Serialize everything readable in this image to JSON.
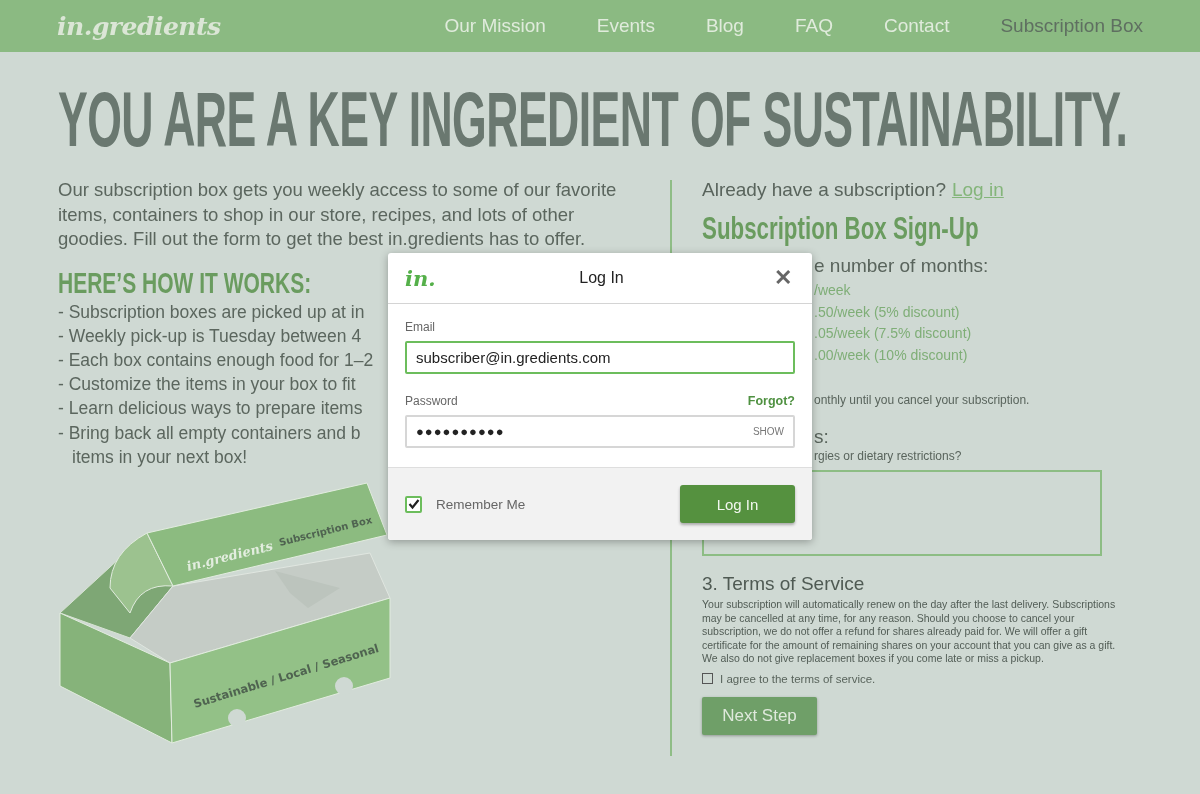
{
  "nav": {
    "logo": "in.gredients",
    "items": [
      {
        "label": "Our Mission",
        "selected": false
      },
      {
        "label": "Events",
        "selected": false
      },
      {
        "label": "Blog",
        "selected": false
      },
      {
        "label": "FAQ",
        "selected": false
      },
      {
        "label": "Contact",
        "selected": false
      },
      {
        "label": "Subscription Box",
        "selected": true
      }
    ]
  },
  "headline": "YOU ARE A KEY INGREDIENT OF SUSTAINABILITY.",
  "intro": "Our subscription box gets you weekly access to some of our favorite items, containers to shop in our store, recipes, and lots of other goodies. Fill out the form to get the best in.gredients has to offer.",
  "how_it_works": {
    "title": "HERE’S HOW IT WORKS:",
    "items": [
      {
        "kind": "bullet",
        "text": "- Subscription boxes are picked up at in"
      },
      {
        "kind": "bullet",
        "text": "- Weekly pick-up is Tuesday between 4"
      },
      {
        "kind": "bullet",
        "text": "- Each box contains enough food for 1–2"
      },
      {
        "kind": "bullet",
        "text": "- Customize the items in your box to fit"
      },
      {
        "kind": "bullet",
        "text": "- Learn delicious ways to prepare items"
      },
      {
        "kind": "bullet",
        "text": "- Bring back all empty containers and b"
      },
      {
        "kind": "continuation",
        "text": "items in your next box!"
      }
    ]
  },
  "box_art": {
    "brand": "in.gredients",
    "lid_label": "Subscription Box",
    "side_label": "Sustainable / Local / Seasonal"
  },
  "signup": {
    "prompt": "Already have a subscription?",
    "login_link": "Log in",
    "title": "Subscription Box Sign-Up",
    "step_1_heading": "e number of months:",
    "options": [
      "/week",
      ".50/week (5% discount)",
      ".05/week (7.5% discount)",
      ".00/week (10% discount)"
    ],
    "renewal_note": "onthly until you cancel your subscription.",
    "step_2_heading": "s:",
    "step_2_question": "rgies or dietary restrictions?",
    "terms": {
      "heading": "3. Terms of Service",
      "body": "Your subscription will automatically renew on the day after the last delivery. Subscriptions may be cancelled at any time, for any reason. Should you choose to cancel your subscription, we do not offer a refund for shares already paid for. We will offer a gift certificate for the amount of remaining shares on your account that you can give as a gift. We also do not give replacement boxes if you come late or miss a pickup.",
      "agree_label": "I agree to the terms of service.",
      "agreed": false
    },
    "next_button": "Next Step"
  },
  "login_modal": {
    "logo": "in.",
    "title": "Log In",
    "close": "✕",
    "email_label": "Email",
    "email_value": "subscriber@in.gredients.com",
    "password_label": "Password",
    "forgot_link": "Forgot?",
    "password_value": "●●●●●●●●●●",
    "show_button": "SHOW",
    "remember_label": "Remember Me",
    "remember": true,
    "submit": "Log In"
  }
}
